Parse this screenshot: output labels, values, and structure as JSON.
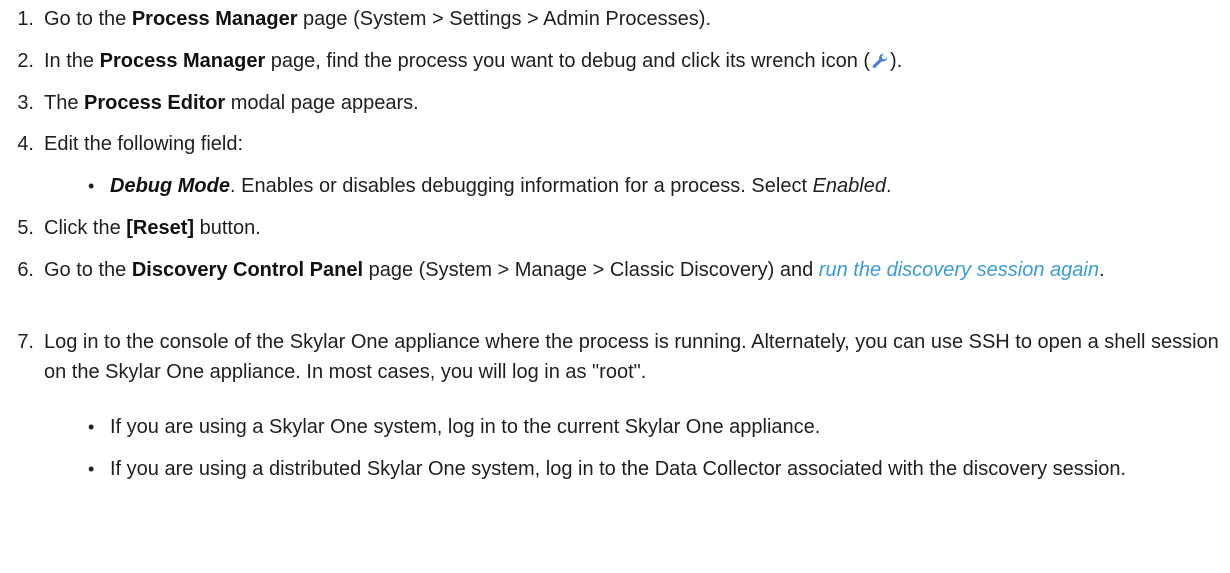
{
  "steps": [
    {
      "num": "1.",
      "a": "Go to the ",
      "b1": "Process Manager",
      "c": " page (System > Settings > Admin Processes)."
    },
    {
      "num": "2.",
      "a": "In the ",
      "b1": "Process Manager",
      "c": " page, find the process you want to debug and click its wrench icon (",
      "d": ")."
    },
    {
      "num": "3.",
      "a": "The ",
      "b1": "Process Editor",
      "c": " modal page appears."
    },
    {
      "num": "4.",
      "a": "Edit the following field:"
    },
    {
      "num": "5.",
      "a": "Click the ",
      "b1": "[Reset]",
      "c": " button."
    },
    {
      "num": "6.",
      "a": "Go to the ",
      "b1": "Discovery Control Panel",
      "c": " page (System > Manage > Classic Discovery) and ",
      "link": "run the discovery session again",
      "d": "."
    },
    {
      "num": "7.",
      "a": "Log in to the console of the Skylar One appliance where the process is running. Alternately, you can use SSH to open a shell session on the Skylar One appliance. In most cases, you will log in as \"root\"."
    }
  ],
  "step4_bullet": {
    "term": "Debug Mode",
    "text": ". Enables or disables debugging information for a process. Select ",
    "value": "Enabled",
    "end": "."
  },
  "step7_bullets": [
    " If you are using a Skylar One system, log in to the current Skylar One appliance.",
    "If you are using a distributed Skylar One system, log in to the Data Collector associated with the discovery session."
  ],
  "bullet_char": "•",
  "icons": {
    "wrench": "wrench-icon"
  },
  "colors": {
    "text": "#1f1f1f",
    "link": "#3a9bd6",
    "wrench": "#4a7fd0"
  }
}
